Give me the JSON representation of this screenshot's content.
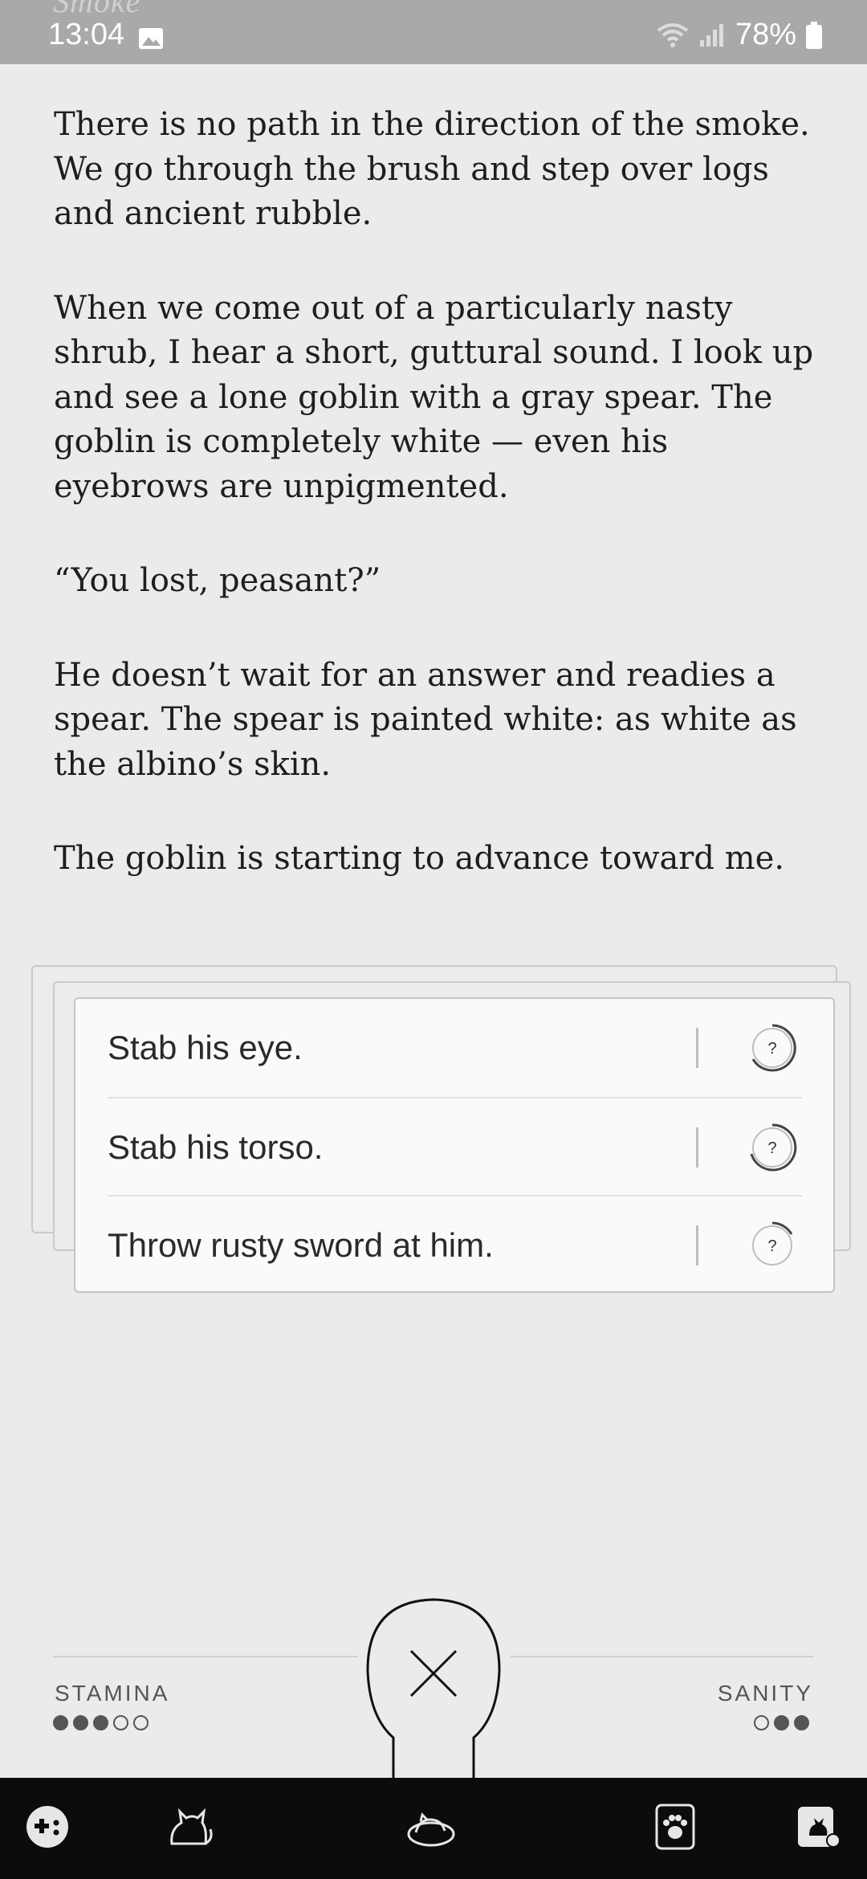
{
  "status_bar": {
    "chapter_title": "Smoke",
    "time": "13:04",
    "battery": "78%"
  },
  "story": {
    "paragraphs": [
      "There is no path in the direction of the smoke. We go through the brush and step over logs and ancient rubble.",
      "When we come out of a particularly nasty shrub, I hear a short, guttural sound. I look up and see a lone goblin with a gray spear. The goblin is completely white — even his eyebrows are unpigmented.",
      "“You lost, peasant?”",
      "He doesn’t wait for an answer and readies a spear. The spear is painted white: as white as the albino’s skin.",
      "The goblin is starting to advance toward me."
    ]
  },
  "choices": [
    {
      "label": "Stab his eye.",
      "help": "?"
    },
    {
      "label": "Stab his torso.",
      "help": "?"
    },
    {
      "label": "Throw rusty sword at him.",
      "help": "?"
    }
  ],
  "stats": {
    "stamina": {
      "label": "STAMINA",
      "value": 3,
      "max": 5
    },
    "sanity": {
      "label": "SANITY",
      "value": 2,
      "max": 3
    }
  },
  "nav": {
    "icons": [
      "gamepad-icon",
      "cat-icon",
      "cat-bed-icon",
      "paw-print-icon",
      "cat-phone-icon"
    ]
  },
  "colors": {
    "background": "#ebebeb",
    "status_bar": "#a9a9a9",
    "nav_bar": "#0c0c0c",
    "text": "#1e1e1e"
  }
}
